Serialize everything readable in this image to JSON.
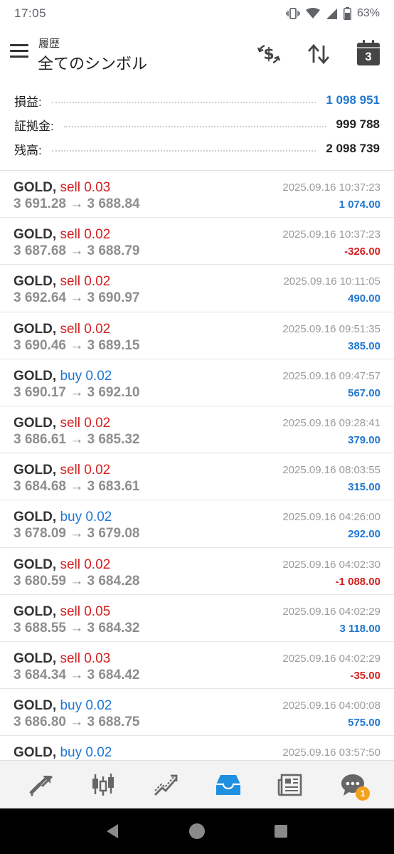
{
  "status_bar": {
    "time": "17:05",
    "battery": "63%"
  },
  "header": {
    "subtitle": "履歴",
    "title": "全てのシンボル"
  },
  "summary": {
    "rows": [
      {
        "label": "損益:",
        "value": "1 098 951",
        "color": "#1f77d0"
      },
      {
        "label": "証拠金:",
        "value": "999 788",
        "color": "#222222"
      },
      {
        "label": "残高:",
        "value": "2 098 739",
        "color": "#222222"
      }
    ]
  },
  "calendar_day": "3",
  "deals": [
    {
      "symbol": "GOLD,",
      "side": "sell",
      "volume": "sell 0.03",
      "prices": "3 691.28 → 3 688.84",
      "time": "2025.09.16 10:37:23",
      "profit": "1 074.00",
      "positive": true
    },
    {
      "symbol": "GOLD,",
      "side": "sell",
      "volume": "sell 0.02",
      "prices": "3 687.68 → 3 688.79",
      "time": "2025.09.16 10:37:23",
      "profit": "-326.00",
      "positive": false
    },
    {
      "symbol": "GOLD,",
      "side": "sell",
      "volume": "sell 0.02",
      "prices": "3 692.64 → 3 690.97",
      "time": "2025.09.16 10:11:05",
      "profit": "490.00",
      "positive": true
    },
    {
      "symbol": "GOLD,",
      "side": "sell",
      "volume": "sell 0.02",
      "prices": "3 690.46 → 3 689.15",
      "time": "2025.09.16 09:51:35",
      "profit": "385.00",
      "positive": true
    },
    {
      "symbol": "GOLD,",
      "side": "buy",
      "volume": "buy 0.02",
      "prices": "3 690.17 → 3 692.10",
      "time": "2025.09.16 09:47:57",
      "profit": "567.00",
      "positive": true
    },
    {
      "symbol": "GOLD,",
      "side": "sell",
      "volume": "sell 0.02",
      "prices": "3 686.61 → 3 685.32",
      "time": "2025.09.16 09:28:41",
      "profit": "379.00",
      "positive": true
    },
    {
      "symbol": "GOLD,",
      "side": "sell",
      "volume": "sell 0.02",
      "prices": "3 684.68 → 3 683.61",
      "time": "2025.09.16 08:03:55",
      "profit": "315.00",
      "positive": true
    },
    {
      "symbol": "GOLD,",
      "side": "buy",
      "volume": "buy 0.02",
      "prices": "3 678.09 → 3 679.08",
      "time": "2025.09.16 04:26:00",
      "profit": "292.00",
      "positive": true
    },
    {
      "symbol": "GOLD,",
      "side": "sell",
      "volume": "sell 0.02",
      "prices": "3 680.59 → 3 684.28",
      "time": "2025.09.16 04:02:30",
      "profit": "-1 088.00",
      "positive": false
    },
    {
      "symbol": "GOLD,",
      "side": "sell",
      "volume": "sell 0.05",
      "prices": "3 688.55 → 3 684.32",
      "time": "2025.09.16 04:02:29",
      "profit": "3 118.00",
      "positive": true
    },
    {
      "symbol": "GOLD,",
      "side": "sell",
      "volume": "sell 0.03",
      "prices": "3 684.34 → 3 684.42",
      "time": "2025.09.16 04:02:29",
      "profit": "-35.00",
      "positive": false
    },
    {
      "symbol": "GOLD,",
      "side": "buy",
      "volume": "buy 0.02",
      "prices": "3 686.80 → 3 688.75",
      "time": "2025.09.16 04:00:08",
      "profit": "575.00",
      "positive": true
    },
    {
      "symbol": "GOLD,",
      "side": "buy",
      "volume": "buy 0.02",
      "prices": "",
      "time": "2025.09.16 03:57:50",
      "profit": "",
      "positive": true
    }
  ],
  "bottom_nav": [
    {
      "name": "quotes-icon",
      "active": false
    },
    {
      "name": "chart-icon",
      "active": false
    },
    {
      "name": "trade-icon",
      "active": false
    },
    {
      "name": "history-icon",
      "active": true
    },
    {
      "name": "news-icon",
      "active": false
    },
    {
      "name": "chat-icon",
      "active": false,
      "badge": "1"
    }
  ],
  "colors": {
    "accent": "#1f77d0",
    "sell": "#d32020",
    "buy": "#1f77d0",
    "badge": "#f4a21c"
  }
}
